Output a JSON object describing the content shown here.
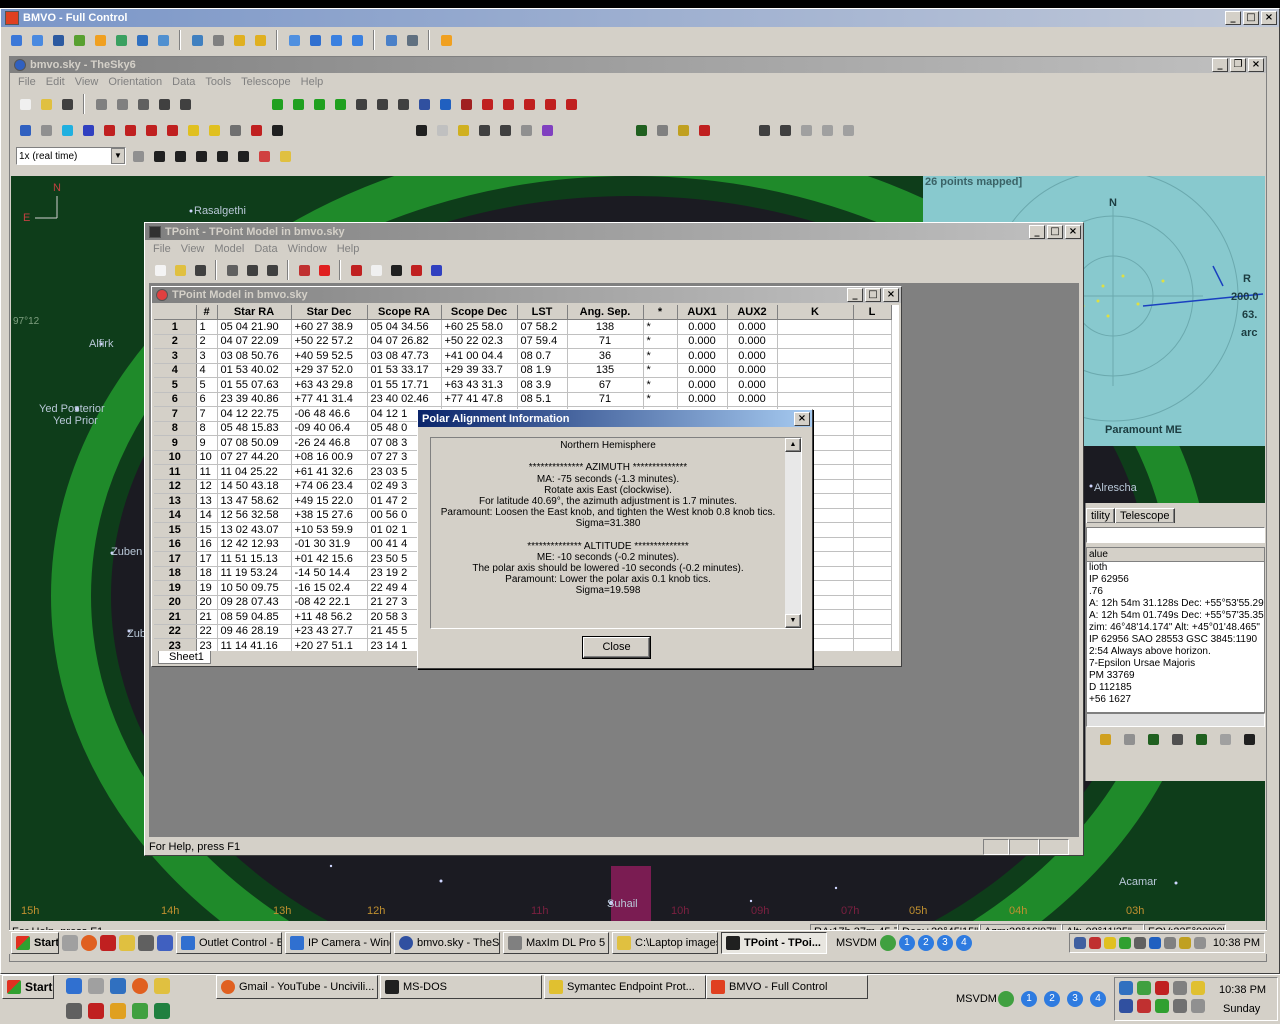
{
  "outer_window": {
    "title": "BMVO - Full Control"
  },
  "sky_window": {
    "title": "bmvo.sky - TheSky6",
    "menu": [
      "File",
      "Edit",
      "View",
      "Orientation",
      "Data",
      "Tools",
      "Telescope",
      "Help"
    ],
    "time_combo": "1x (real time)",
    "labels": {
      "compass_n": "N",
      "compass_e": "E",
      "rasalgethi": "Rasalgethi",
      "alfirk": "Alfirk",
      "yed_posterior": "Yed Posterior",
      "yed_prior": "Yed Prior",
      "zuben1": "Zuben",
      "zuben2": "Zub",
      "suhail": "Suhail",
      "acamar": "Acamar",
      "alrescha": "Alrescha",
      "left_12": "97°12",
      "hours": [
        "15h",
        "14h",
        "13h",
        "12h",
        "11h",
        "10h",
        "09h",
        "07h",
        "05h",
        "04h",
        "03h"
      ]
    },
    "status": {
      "help": "For Help, press F1",
      "ra": "RA:17h 37m 45.7s",
      "dec": "Dec:+29°45'15\"",
      "azm": "Azm:38°16'07\"",
      "alt": "Alt:-08°11'35\"",
      "fov": "FOV:225°00'00\""
    }
  },
  "map_panel": {
    "header": "26 points mapped]",
    "n": "N",
    "r": "R",
    "v1": "200.0",
    "v2": "63.",
    "v3": "arc",
    "caption": "Paramount ME"
  },
  "info_panel": {
    "tabs": [
      "tility",
      "Telescope"
    ],
    "col_header": "alue",
    "rows": [
      "lioth",
      "IP 62956",
      ".76",
      "A: 12h 54m 31.128s  Dec: +55°53'55.29",
      "A: 12h 54m 01.749s  Dec: +55°57'35.35",
      "zim: 46°48'14.174\"  Alt: +45°01'48.465\"",
      "IP 62956 SAO 28553  GSC 3845:1190",
      "2:54  Always above horizon.",
      "7-Epsilon Ursae Majoris",
      "PM 33769",
      "D 112185",
      "+56 1627"
    ]
  },
  "tpoint_window": {
    "title": "TPoint - TPoint Model in bmvo.sky",
    "menu": [
      "File",
      "View",
      "Model",
      "Data",
      "Window",
      "Help"
    ],
    "status": "For Help, press F1"
  },
  "model_window": {
    "title": "TPoint Model in bmvo.sky",
    "sheet_tab": "Sheet1",
    "columns": [
      "#",
      "Star RA",
      "Star Dec",
      "Scope RA",
      "Scope Dec",
      "LST",
      "Ang. Sep.",
      "*",
      "AUX1",
      "AUX2",
      "K",
      "L"
    ],
    "rows": [
      [
        "1",
        "1",
        "05 04 21.90",
        "+60 27 38.9",
        "05 04 34.56",
        "+60 25 58.0",
        "07 58.2",
        "138",
        "*",
        "0.000",
        "0.000"
      ],
      [
        "2",
        "2",
        "04 07 22.09",
        "+50 22 57.2",
        "04 07 26.82",
        "+50 22 02.3",
        "07 59.4",
        "71",
        "*",
        "0.000",
        "0.000"
      ],
      [
        "3",
        "3",
        "03 08 50.76",
        "+40 59 52.5",
        "03 08 47.73",
        "+41 00 04.4",
        "08  0.7",
        "36",
        "*",
        "0.000",
        "0.000"
      ],
      [
        "4",
        "4",
        "01 53 40.02",
        "+29 37 52.0",
        "01 53 33.17",
        "+29 39 33.7",
        "08  1.9",
        "135",
        "*",
        "0.000",
        "0.000"
      ],
      [
        "5",
        "5",
        "01 55 07.63",
        "+63 43 29.8",
        "01 55 17.71",
        "+63 43 31.3",
        "08  3.9",
        "67",
        "*",
        "0.000",
        "0.000"
      ],
      [
        "6",
        "6",
        "23 39 40.86",
        "+77 41 31.4",
        "23 40 02.46",
        "+77 41 47.8",
        "08  5.1",
        "71",
        "*",
        "0.000",
        "0.000"
      ],
      [
        "7",
        "7",
        "04 12 22.75",
        "-06 48 46.6",
        "04 12 1",
        "",
        "",
        "",
        "",
        "",
        ""
      ],
      [
        "8",
        "8",
        "05 48 15.83",
        "-09 40 06.4",
        "05 48 0",
        "",
        "",
        "",
        "",
        "",
        ""
      ],
      [
        "9",
        "9",
        "07 08 50.09",
        "-26 24 46.8",
        "07 08 3",
        "",
        "",
        "",
        "",
        "",
        ""
      ],
      [
        "10",
        "10",
        "07 27 44.20",
        "+08 16 00.9",
        "07 27 3",
        "",
        "",
        "",
        "",
        "",
        ""
      ],
      [
        "11",
        "11",
        "11 04 25.22",
        "+61 41 32.6",
        "23 03 5",
        "",
        "",
        "",
        "",
        "",
        ""
      ],
      [
        "12",
        "12",
        "14 50 43.18",
        "+74 06 23.4",
        "02 49 3",
        "",
        "",
        "",
        "",
        "",
        ""
      ],
      [
        "13",
        "13",
        "13 47 58.62",
        "+49 15 22.0",
        "01 47 2",
        "",
        "",
        "",
        "",
        "",
        ""
      ],
      [
        "14",
        "14",
        "12 56 32.58",
        "+38 15 27.6",
        "00 56 0",
        "",
        "",
        "",
        "",
        "",
        ""
      ],
      [
        "15",
        "15",
        "13 02 43.07",
        "+10 53 59.9",
        "01 02 1",
        "",
        "",
        "",
        "",
        "",
        ""
      ],
      [
        "16",
        "16",
        "12 42 12.93",
        "-01 30 31.9",
        "00 41 4",
        "",
        "",
        "",
        "",
        "",
        ""
      ],
      [
        "17",
        "17",
        "11 51 15.13",
        "+01 42 15.6",
        "23 50 5",
        "",
        "",
        "",
        "",
        "",
        ""
      ],
      [
        "18",
        "18",
        "11 19 53.24",
        "-14 50 14.4",
        "23 19 2",
        "",
        "",
        "",
        "",
        "",
        ""
      ],
      [
        "19",
        "19",
        "10 50 09.75",
        "-16 15 02.4",
        "22 49 4",
        "",
        "",
        "",
        "",
        "",
        ""
      ],
      [
        "20",
        "20",
        "09 28 07.43",
        "-08 42 22.1",
        "21 27 3",
        "",
        "",
        "",
        "",
        "",
        ""
      ],
      [
        "21",
        "21",
        "08 59 04.85",
        "+11 48 56.2",
        "20 58 3",
        "",
        "",
        "",
        "",
        "",
        ""
      ],
      [
        "22",
        "22",
        "09 46 28.19",
        "+23 43 27.7",
        "21 45 5",
        "",
        "",
        "",
        "",
        "",
        ""
      ],
      [
        "23",
        "23",
        "11 14 41.16",
        "+20 27 51.1",
        "23 14 1",
        "",
        "",
        "",
        "",
        "",
        ""
      ]
    ]
  },
  "polar_dialog": {
    "title": "Polar Alignment Information",
    "lines": [
      "Northern Hemisphere",
      "",
      "************** AZIMUTH **************",
      "MA: -75 seconds (-1.3 minutes).",
      "Rotate axis East (clockwise).",
      "For latitude 40.69°, the azimuth adjustment is 1.7 minutes.",
      "Paramount: Loosen the East knob, and tighten the West knob 0.8 knob tics.",
      "Sigma=31.380",
      "",
      "************** ALTITUDE **************",
      "ME: -10 seconds (-0.2 minutes).",
      "The polar axis should be lowered -10 seconds (-0.2 minutes).",
      "Paramount: Lower the polar axis 0.1 knob tics.",
      "Sigma=19.598"
    ],
    "close_label": "Close"
  },
  "inner_taskbar": {
    "start": "Start",
    "tasks": [
      "Outlet Control - B...",
      "IP Camera - Wind...",
      "bmvo.sky - TheS...",
      "MaxIm DL Pro 5 -...",
      "C:\\Laptop images...",
      "TPoint - TPoi..."
    ],
    "msvdm": "MSVDM",
    "desktops": [
      "1",
      "2",
      "3",
      "4"
    ],
    "clock": "10:38 PM"
  },
  "outer_taskbar": {
    "start": "Start",
    "tasks": [
      "Gmail - YouTube - Uncivili...",
      "MS-DOS",
      "Symantec Endpoint Prot...",
      "BMVO - Full Control"
    ],
    "msvdm": "MSVDM",
    "desktops": [
      "1",
      "2",
      "3",
      "4"
    ],
    "clock": "10:38 PM",
    "day": "Sunday"
  },
  "colors": {
    "sky": "#0e3d1a",
    "title_active": "#0a246a",
    "map_bg": "#88c9ce"
  }
}
